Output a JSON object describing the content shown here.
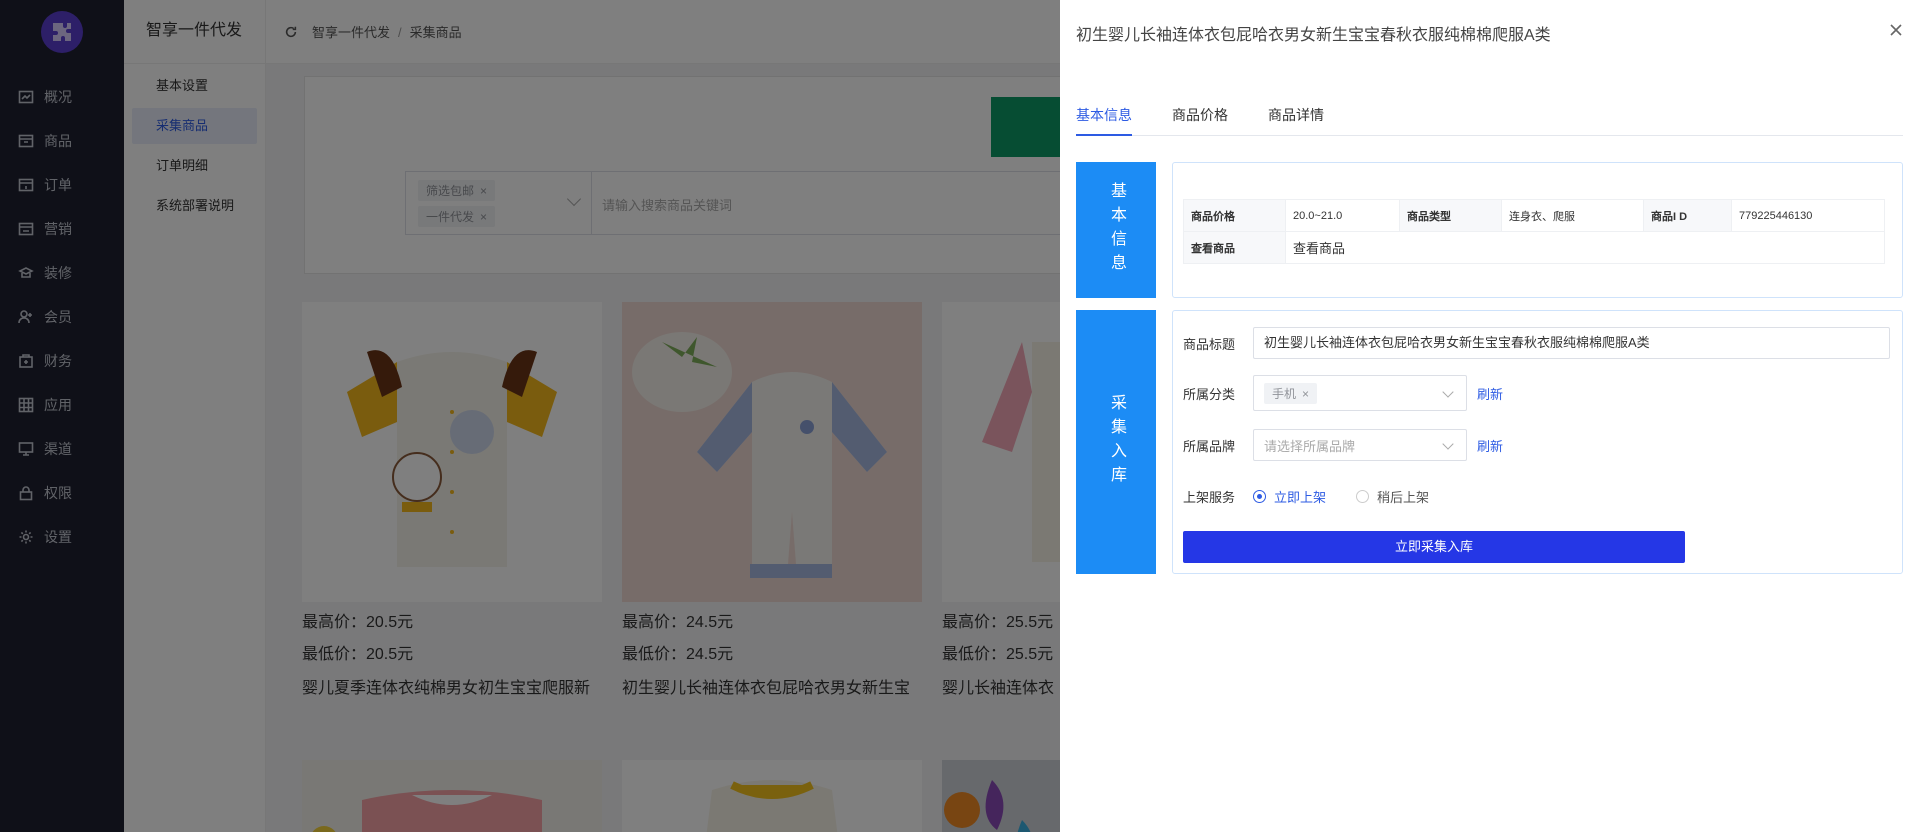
{
  "nav": {
    "items": [
      {
        "label": "概况",
        "icon": "chart-icon"
      },
      {
        "label": "商品",
        "icon": "goods-icon"
      },
      {
        "label": "订单",
        "icon": "order-icon"
      },
      {
        "label": "营销",
        "icon": "marketing-icon"
      },
      {
        "label": "装修",
        "icon": "decorate-icon"
      },
      {
        "label": "会员",
        "icon": "member-icon"
      },
      {
        "label": "财务",
        "icon": "finance-icon"
      },
      {
        "label": "应用",
        "icon": "apps-icon"
      },
      {
        "label": "渠道",
        "icon": "channel-icon"
      },
      {
        "label": "权限",
        "icon": "lock-icon"
      },
      {
        "label": "设置",
        "icon": "gear-icon"
      }
    ]
  },
  "submenu": {
    "app_title": "智享一件代发",
    "items": [
      "基本设置",
      "采集商品",
      "订单明细",
      "系统部署说明"
    ],
    "active_index": 1
  },
  "breadcrumb": {
    "items": [
      "智享一件代发",
      "采集商品"
    ]
  },
  "filter": {
    "tags": [
      "筛选包邮",
      "一件代发"
    ],
    "search_placeholder": "请输入搜索商品关键词"
  },
  "products": [
    {
      "max_price": "最高价：20.5元",
      "min_price": "最低价：20.5元",
      "name": "婴儿夏季连体衣纯棉男女初生宝宝爬服新"
    },
    {
      "max_price": "最高价：24.5元",
      "min_price": "最低价：24.5元",
      "name": "初生婴儿长袖连体衣包屁哈衣男女新生宝"
    },
    {
      "max_price": "最高价：25.5元",
      "min_price": "最低价：25.5元",
      "name": "婴儿长袖连体衣"
    }
  ],
  "drawer": {
    "title": "初生婴儿长袖连体衣包屁哈衣男女新生宝宝春秋衣服纯棉棉爬服A类",
    "tabs": [
      "基本信息",
      "商品价格",
      "商品详情"
    ],
    "active_tab": 0,
    "basic_section": {
      "label": "基本信息",
      "rows": [
        [
          {
            "k": "商品价格",
            "v": "20.0~21.0"
          },
          {
            "k": "商品类型",
            "v": "连身衣、爬服"
          },
          {
            "k": "商品I D",
            "v": "779225446130"
          }
        ],
        [
          {
            "k": "查看商品",
            "v": "查看商品"
          }
        ]
      ]
    },
    "collect_section": {
      "label": "采集入库",
      "title_label": "商品标题",
      "title_value": "初生婴儿长袖连体衣包屁哈衣男女新生宝宝春秋衣服纯棉棉爬服A类",
      "category_label": "所属分类",
      "category_tag": "手机",
      "brand_label": "所属品牌",
      "brand_placeholder": "请选择所属品牌",
      "refresh_label": "刷新",
      "service_label": "上架服务",
      "service_options": [
        "立即上架",
        "稍后上架"
      ],
      "service_selected": 0,
      "submit_label": "立即采集入库"
    }
  },
  "colors": {
    "primary": "#2d5be3",
    "section_label": "#1c8cf5",
    "submit": "#2537e6",
    "rail": "#1e2130"
  }
}
